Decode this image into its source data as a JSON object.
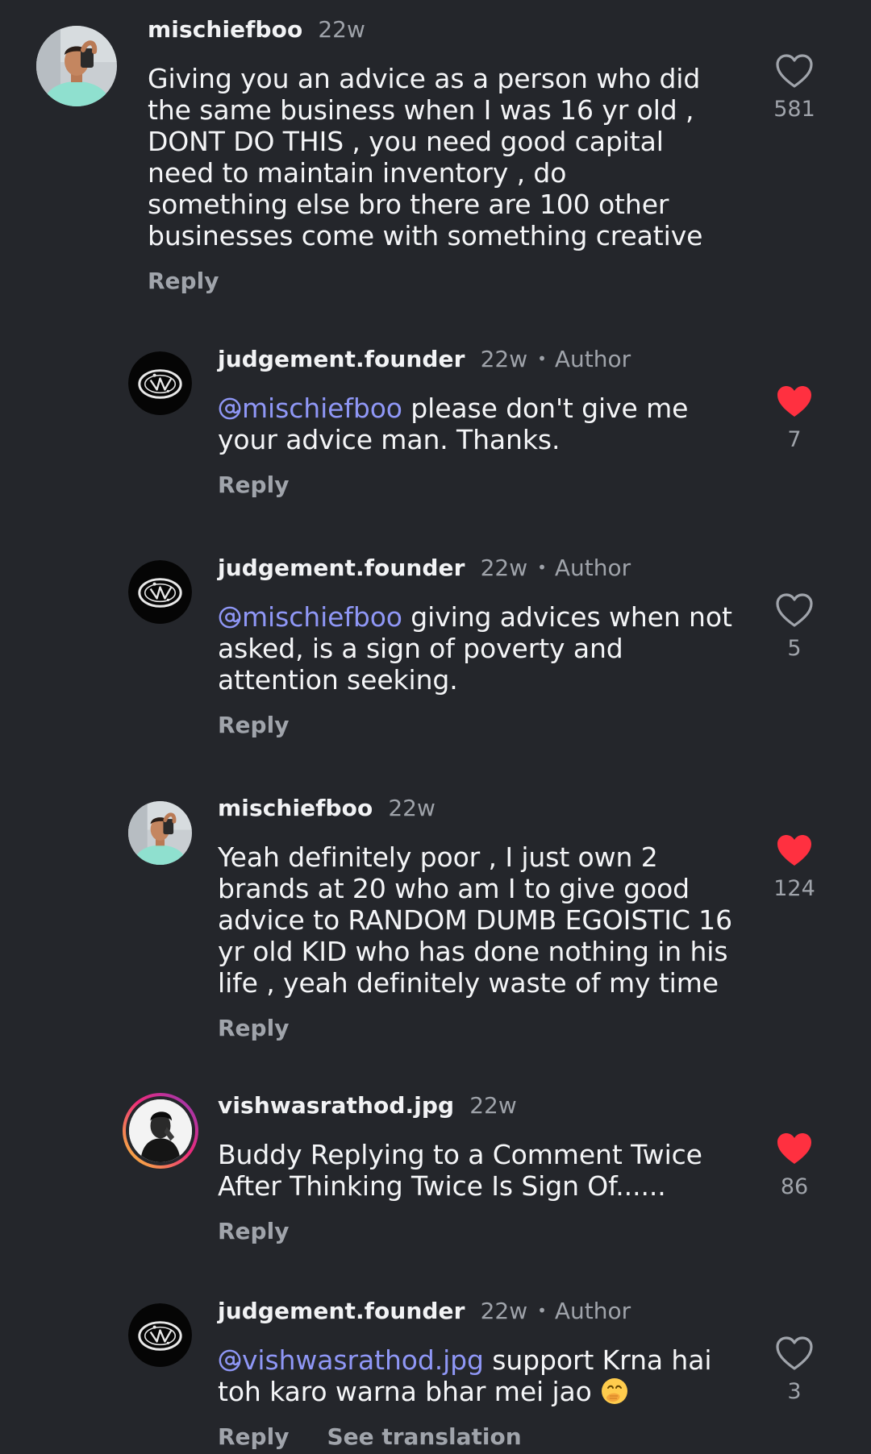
{
  "comments": [
    {
      "username": "mischiefboo",
      "time": "22w",
      "text": "Giving you an advice as a person who did the same business when I was 16 yr old , DONT DO THIS , you need good capital need to maintain inventory , do something else bro there are 100 other businesses come with something creative",
      "reply_label": "Reply",
      "likes": "581",
      "liked": false
    },
    {
      "username": "judgement.founder",
      "time": "22w",
      "author_badge": "Author",
      "mention": "mischiefboo",
      "text": " please don't give me your advice man. Thanks.",
      "reply_label": "Reply",
      "likes": "7",
      "liked": true
    },
    {
      "username": "judgement.founder",
      "time": "22w",
      "author_badge": "Author",
      "mention": "mischiefboo",
      "text": " giving advices when not asked, is a sign of poverty and attention seeking.",
      "reply_label": "Reply",
      "likes": "5",
      "liked": false
    },
    {
      "username": "mischiefboo",
      "time": "22w",
      "text": "Yeah definitely poor , I just own 2 brands at 20 who am I to give good advice to RANDOM DUMB EGOISTIC 16 yr old KID who has done nothing in his life , yeah definitely waste of my time",
      "reply_label": "Reply",
      "likes": "124",
      "liked": true
    },
    {
      "username": "vishwasrathod.jpg",
      "time": "22w",
      "text": "Buddy Replying to a Comment Twice After Thinking Twice Is Sign Of......",
      "reply_label": "Reply",
      "likes": "86",
      "liked": true
    },
    {
      "username": "judgement.founder",
      "time": "22w",
      "author_badge": "Author",
      "mention": "vishwasrathod.jpg",
      "text": " support Krna hai toh karo warna bhar mei jao",
      "emoji": "face-with-hand-over-mouth",
      "reply_label": "Reply",
      "translate_label": "See translation",
      "likes": "3",
      "liked": false
    }
  ],
  "colors": {
    "background": "#24262b",
    "mention": "#8f97f6",
    "liked_heart": "#ff3040",
    "secondary_text": "#a0a4ab"
  },
  "icons": {
    "like_empty": "heart-outline-icon",
    "like_filled": "heart-filled-icon",
    "mention_prefix": "threads-at-icon"
  }
}
